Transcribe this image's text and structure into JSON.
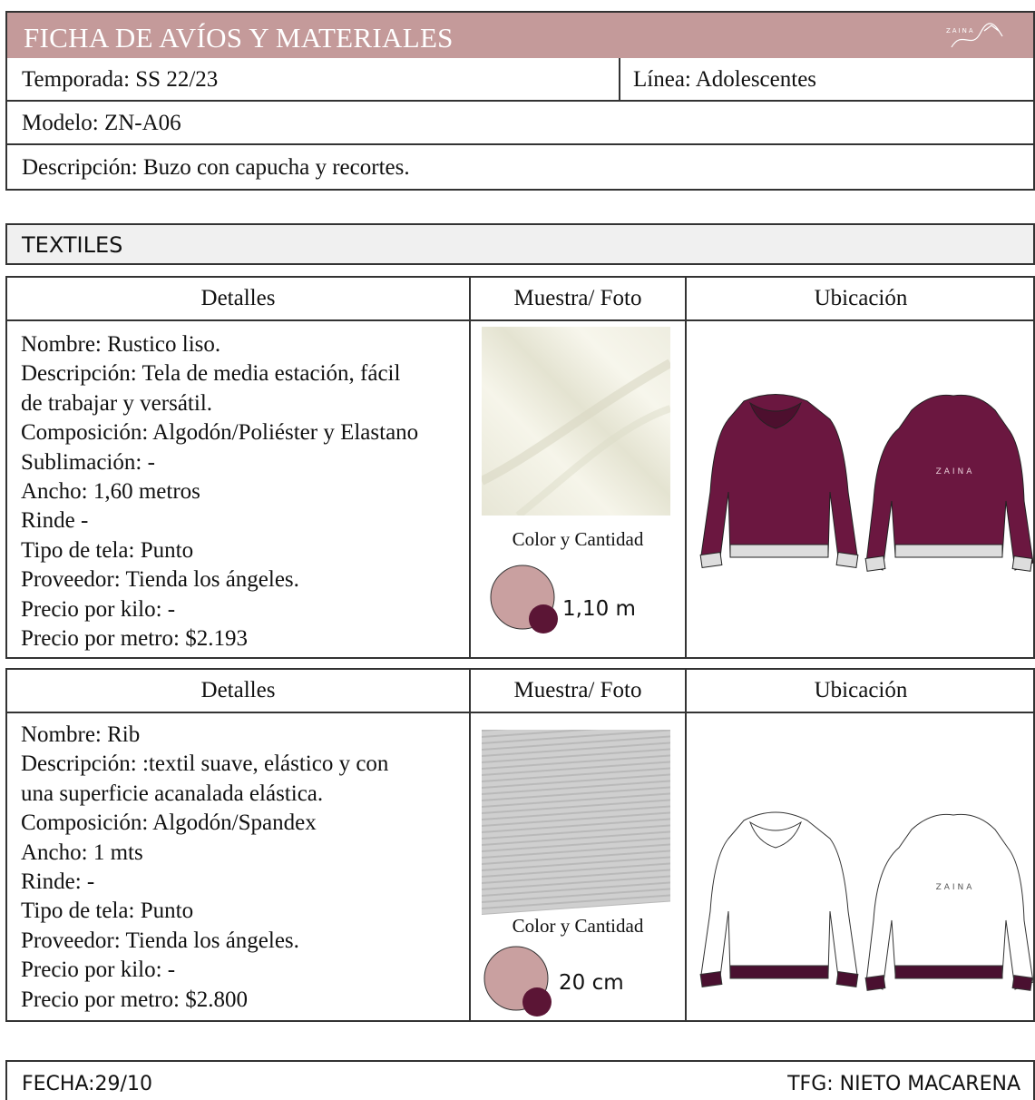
{
  "header": {
    "title": "FICHA DE AVÍOS Y MATERIALES",
    "logo_text": "ZAINA"
  },
  "info": {
    "temporada": "Temporada: SS 22/23",
    "linea": "Línea:  Adolescentes",
    "modelo": "Modelo: ZN-A06",
    "descripcion": "Descripción: Buzo con capucha y recortes."
  },
  "section": {
    "title": "TEXTILES"
  },
  "tables": [
    {
      "headers": {
        "details": "Detalles",
        "sample": "Muestra/ Foto",
        "location": "Ubicación"
      },
      "details": [
        "Nombre: Rustico liso.",
        "Descripción: Tela de media estación, fácil",
        "de trabajar y versátil.",
        "Composición: Algodón/Poliéster y Elastano",
        "Sublimación: -",
        "Ancho: 1,60 metros",
        "Rinde -",
        "Tipo de tela: Punto",
        "Proveedor: Tienda los ángeles.",
        "Precio por kilo: -",
        "Precio por metro: $2.193"
      ],
      "swatch_label": "Color y Cantidad",
      "quantity": "1,10 m",
      "garment_logo": "ZAINA"
    },
    {
      "headers": {
        "details": "Detalles",
        "sample": "Muestra/ Foto",
        "location": "Ubicación"
      },
      "details": [
        "Nombre: Rib",
        "Descripción: :textil suave, elástico y con",
        "una superficie acanalada elástica.",
        "Composición: Algodón/Spandex",
        "Ancho: 1 mts",
        "Rinde: -",
        "Tipo de tela: Punto",
        "Proveedor:  Tienda los ángeles.",
        "Precio por kilo: -",
        "Precio por metro: $2.800"
      ],
      "swatch_label": "Color y Cantidad",
      "quantity": "20 cm",
      "garment_logo": "ZAINA"
    }
  ],
  "colors": {
    "header_bg": "#c49a9a",
    "swatch_pink": "#c9a0a0",
    "swatch_burgundy": "#5b1535",
    "hoodie_burgundy": "#6b1740",
    "fabric_cream": "#f1f0e4",
    "fabric_grey": "#c8c8c8"
  },
  "footer": {
    "fecha": "FECHA:29/10",
    "tfg": "TFG: NIETO MACARENA"
  }
}
